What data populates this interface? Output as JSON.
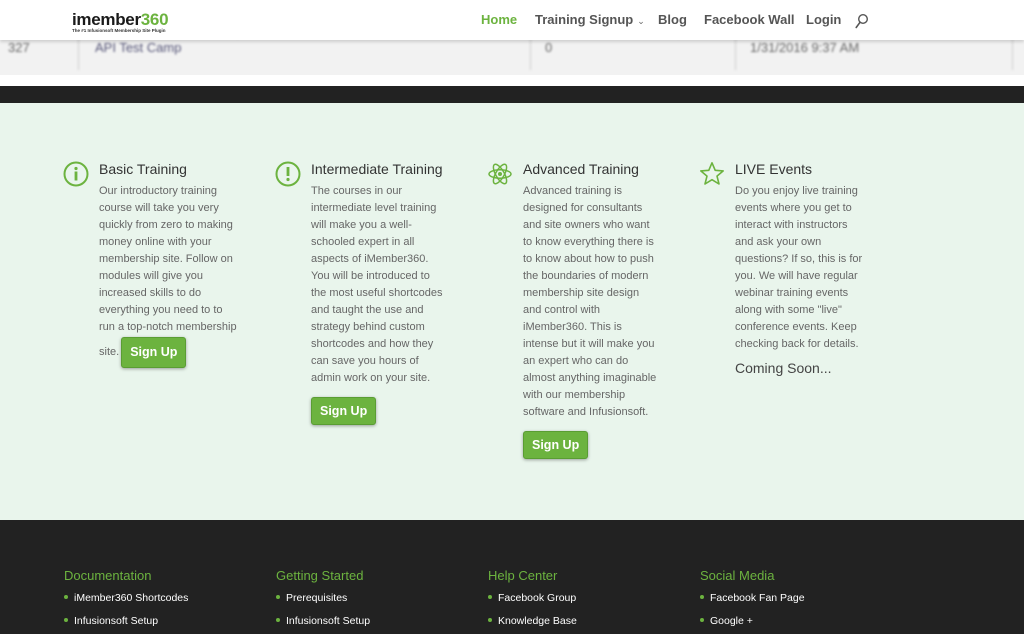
{
  "header": {
    "logo": {
      "main": "imember",
      "accent": "360",
      "tagline": "The #1 Infusionsoft Membership Site Plugin"
    },
    "nav": [
      {
        "label": "Home",
        "active": true
      },
      {
        "label": "Training Signup",
        "has_dropdown": true
      },
      {
        "label": "Blog"
      },
      {
        "label": "Facebook Wall"
      },
      {
        "label": "Login"
      }
    ],
    "search_icon": "search-icon"
  },
  "background_row": {
    "id": "327",
    "name": "API Test Camp",
    "count": "0",
    "date": "1/31/2016 9:37 AM"
  },
  "features": [
    {
      "icon": "info-circle-icon",
      "title": "Basic Training",
      "body": "Our introductory training course will take you very quickly from zero to making money online with your membership site.  Follow on modules will give you increased skills to do everything you need to to run a top-notch membership site.",
      "button": "Sign Up"
    },
    {
      "icon": "exclamation-circle-icon",
      "title": "Intermediate Training",
      "body": "The courses in our intermediate level training will make you a well-schooled expert in all aspects of iMember360.  You will be introduced to the most useful shortcodes and taught the use and strategy behind custom shortcodes and how they can save you hours of admin work on your site.",
      "button": "Sign Up"
    },
    {
      "icon": "atom-icon",
      "title": "Advanced Training",
      "body": "Advanced training is designed for consultants and site owners who want to know everything there is to know about how to push the boundaries of modern membership site design and control with iMember360.  This is intense but it will make you an expert who can do almost anything imaginable with our membership software and Infusionsoft.",
      "button": "Sign Up"
    },
    {
      "icon": "star-icon",
      "title": "LIVE Events",
      "body": "Do you enjoy live training events where you get to interact with instructors and ask your own questions?  If so, this is for you.  We will have regular webinar training events along with some \"live\" conference events.  Keep checking back for details.",
      "note": "Coming Soon..."
    }
  ],
  "footer": {
    "columns": [
      {
        "title": "Documentation",
        "items": [
          "iMember360 Shortcodes",
          "Infusionsoft Setup"
        ]
      },
      {
        "title": "Getting Started",
        "items": [
          "Prerequisites",
          "Infusionsoft Setup"
        ]
      },
      {
        "title": "Help Center",
        "items": [
          "Facebook Group",
          "Knowledge Base"
        ]
      },
      {
        "title": "Social Media",
        "items": [
          "Facebook Fan Page",
          "Google +"
        ]
      }
    ]
  },
  "colors": {
    "accent": "#6cb33f",
    "dark": "#222222",
    "feature_bg": "#e9f5ec"
  }
}
